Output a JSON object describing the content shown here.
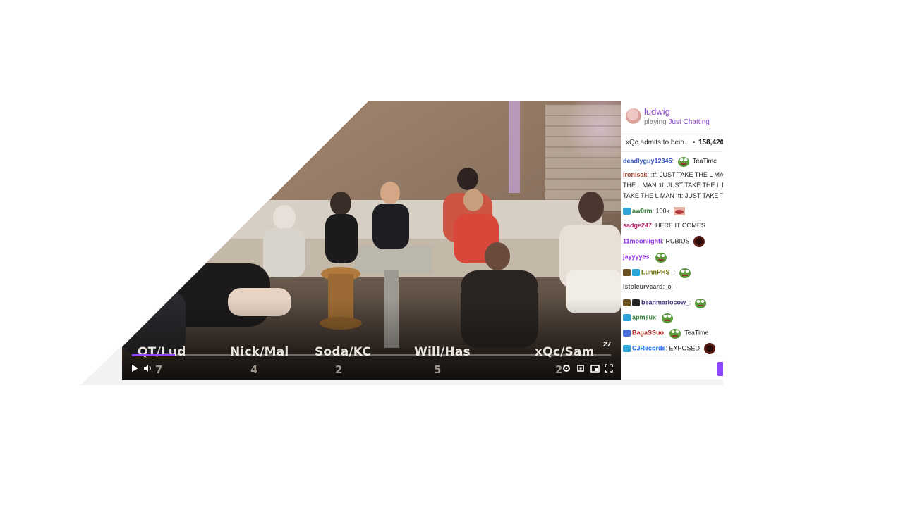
{
  "video": {
    "overlay_labels": [
      "QT/Lud",
      "Nick/Mal",
      "Soda/KC",
      "Will/Has",
      "xQc/Sam"
    ],
    "overlay_numbers": [
      "7",
      "4",
      "2",
      "5",
      "2"
    ],
    "viewer_badge": "27",
    "progress": 0.09,
    "controls": [
      "play-icon",
      "volume-icon",
      "settings-icon",
      "clip-icon",
      "theatre-icon",
      "fullscreen-icon"
    ]
  },
  "chat": {
    "channel_name": "ludwig",
    "playing_prefix": "playing",
    "game": "Just Chatting",
    "stream_title": "xQc admits to bein...",
    "separator": "•",
    "views": "158,420",
    "messages": [
      {
        "user": "deadlyguy12345",
        "text": "TeaTime",
        "color": "#1e69ff"
      },
      {
        "user": "ironisak",
        "text": ":tf: JUST TAKE THE L MA",
        "color": "#b22222"
      },
      {
        "user": "",
        "text": "THE L MAN :tf: JUST TAKE THE L M",
        "color": "#222"
      },
      {
        "user": "",
        "text": "TAKE THE L MAN :tf: JUST TAKE T",
        "color": "#222"
      },
      {
        "user": "aw0rm",
        "text": "100k",
        "color": "#2e7d32"
      },
      {
        "user": "sadge247",
        "text": "HERE IT COMES",
        "color": "#b0266b"
      },
      {
        "user": "11moonlighti",
        "text": "RUBIUS",
        "color": "#8a2be2"
      },
      {
        "user": "jayyyyes",
        "text": "",
        "color": "#8a2be2"
      },
      {
        "user": "LunnPHS_",
        "text": "",
        "color": "#6b6b00"
      },
      {
        "user": "lstoleurvcard",
        "text": "lol",
        "color": "#555"
      },
      {
        "user": "beanmariocow_",
        "text": "",
        "color": "#3c2f7a"
      },
      {
        "user": "apmsux",
        "text": "",
        "color": "#2e7d32"
      },
      {
        "user": "BagaSSuo",
        "text": "TeaTime",
        "color": "#b22222"
      },
      {
        "user": "CJRecords",
        "text": "EXPOSED",
        "color": "#1e69ff"
      }
    ]
  },
  "colors": {
    "accent": "#9147ff",
    "channel": "#8b4ac9"
  }
}
